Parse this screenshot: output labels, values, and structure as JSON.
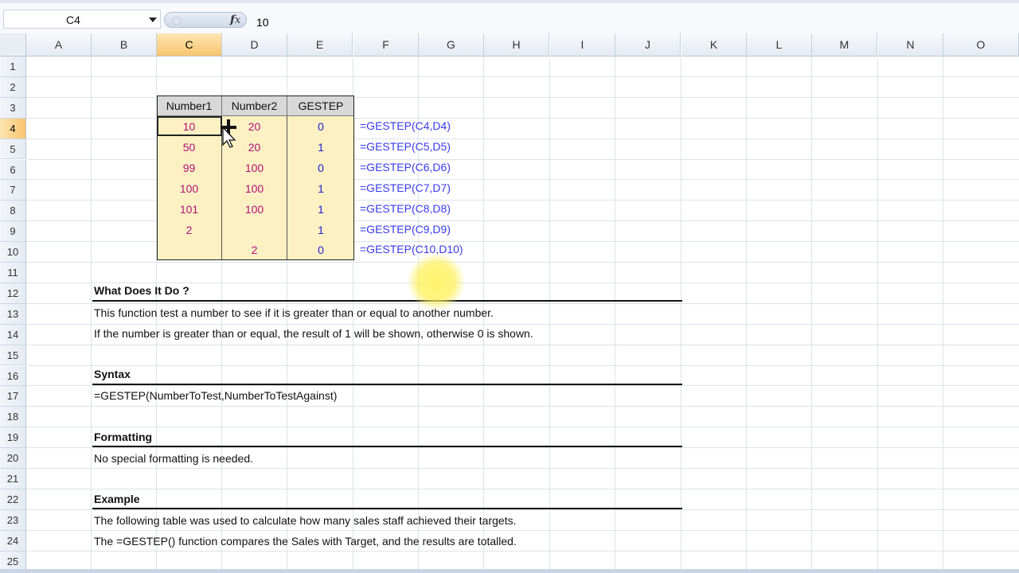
{
  "formula_bar": {
    "name_box": "C4",
    "value": "10"
  },
  "columns": [
    "A",
    "B",
    "C",
    "D",
    "E",
    "F",
    "G",
    "H",
    "I",
    "J",
    "K",
    "L",
    "M",
    "N",
    "O"
  ],
  "selected_column": "C",
  "rows": [
    "1",
    "2",
    "3",
    "4",
    "5",
    "6",
    "7",
    "8",
    "9",
    "10",
    "11",
    "12",
    "13",
    "14",
    "15",
    "16",
    "17",
    "18",
    "19",
    "20",
    "21",
    "22",
    "23",
    "24",
    "25"
  ],
  "selected_row": "4",
  "table": {
    "headers": [
      "Number1",
      "Number2",
      "GESTEP"
    ],
    "rows": [
      {
        "n1": "10",
        "n2": "20",
        "g": "0",
        "formula": "=GESTEP(C4,D4)"
      },
      {
        "n1": "50",
        "n2": "20",
        "g": "1",
        "formula": "=GESTEP(C5,D5)"
      },
      {
        "n1": "99",
        "n2": "100",
        "g": "0",
        "formula": "=GESTEP(C6,D6)"
      },
      {
        "n1": "100",
        "n2": "100",
        "g": "1",
        "formula": "=GESTEP(C7,D7)"
      },
      {
        "n1": "101",
        "n2": "100",
        "g": "1",
        "formula": "=GESTEP(C8,D8)"
      },
      {
        "n1": "2",
        "n2": "",
        "g": "1",
        "formula": "=GESTEP(C9,D9)"
      },
      {
        "n1": "",
        "n2": "2",
        "g": "0",
        "formula": "=GESTEP(C10,D10)"
      }
    ]
  },
  "sections": {
    "what_heading": "What Does It Do ?",
    "what_line1": "This function test a number to see if it is greater than or equal to another number.",
    "what_line2": "If the number is greater than or equal, the result of 1 will be shown, otherwise 0 is shown.",
    "syntax_heading": "Syntax",
    "syntax_line": "=GESTEP(NumberToTest,NumberToTestAgainst)",
    "formatting_heading": "Formatting",
    "formatting_line": "No special formatting is needed.",
    "example_heading": "Example",
    "example_line1": "The following table was used to calculate how many sales staff achieved their targets.",
    "example_line2": "The =GESTEP() function compares the Sales with Target, and the results are totalled."
  },
  "colors": {
    "header_fill": "#d8d8d8",
    "cell_fill": "#fdf1c3",
    "value_color": "#b0107a",
    "formula_color": "#3a3aee",
    "selection": "#f8c46e"
  }
}
